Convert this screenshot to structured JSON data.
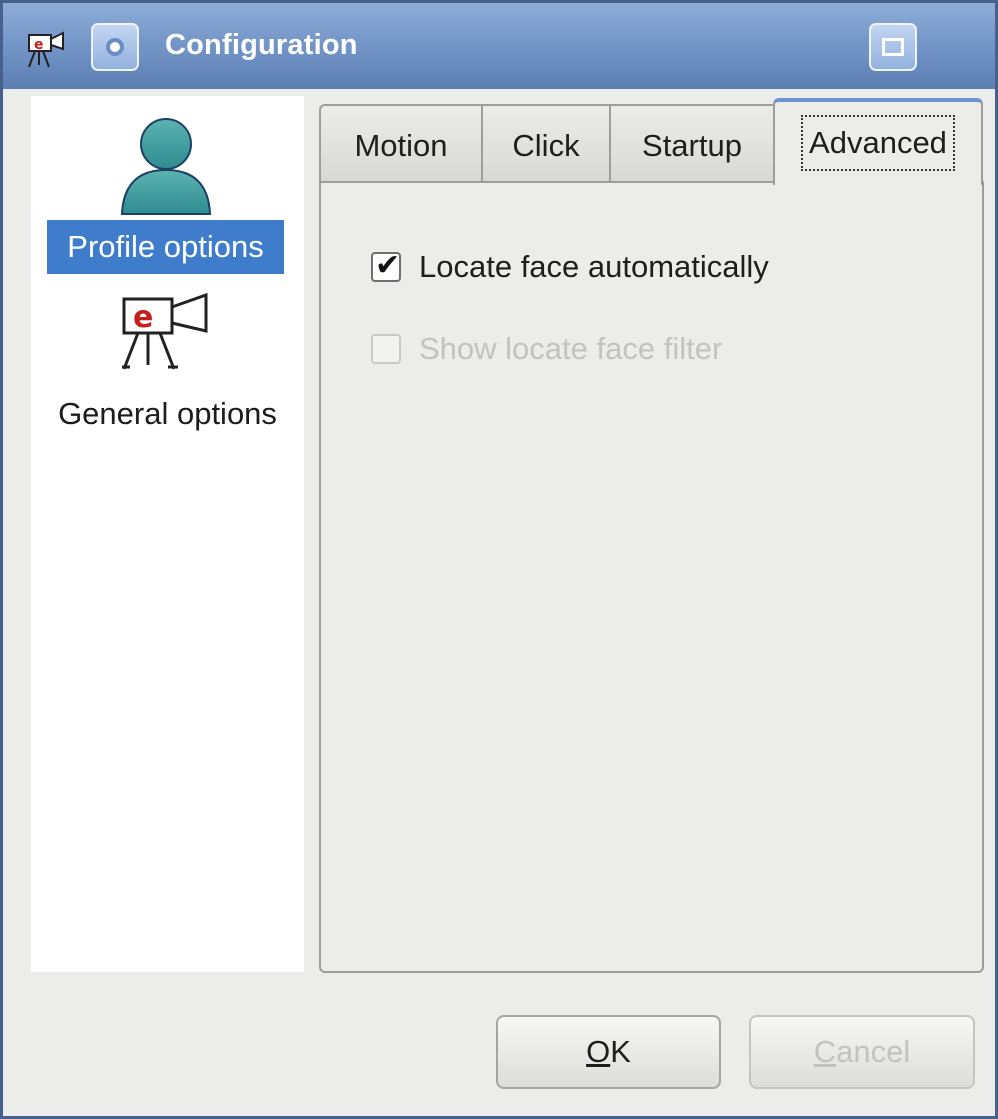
{
  "window": {
    "title": "Configuration"
  },
  "sidebar": {
    "items": [
      {
        "label": "Profile options",
        "icon": "user-icon",
        "selected": true
      },
      {
        "label": "General options",
        "icon": "camera-icon",
        "selected": false
      }
    ]
  },
  "tabs": [
    {
      "label": "Motion"
    },
    {
      "label": "Click"
    },
    {
      "label": "Startup"
    },
    {
      "label": "Advanced",
      "active": true
    }
  ],
  "options": [
    {
      "label": "Locate face automatically",
      "checked": true,
      "enabled": true
    },
    {
      "label": "Show locate face filter",
      "checked": false,
      "enabled": false
    }
  ],
  "buttons": {
    "ok": {
      "mnemonic": "O",
      "rest": "K"
    },
    "cancel": {
      "mnemonic": "C",
      "rest": "ancel",
      "enabled": false
    }
  },
  "colors": {
    "titlebar": "#7597c8",
    "selection": "#3f7ccc",
    "active_tab_accent": "#6d93cc"
  }
}
